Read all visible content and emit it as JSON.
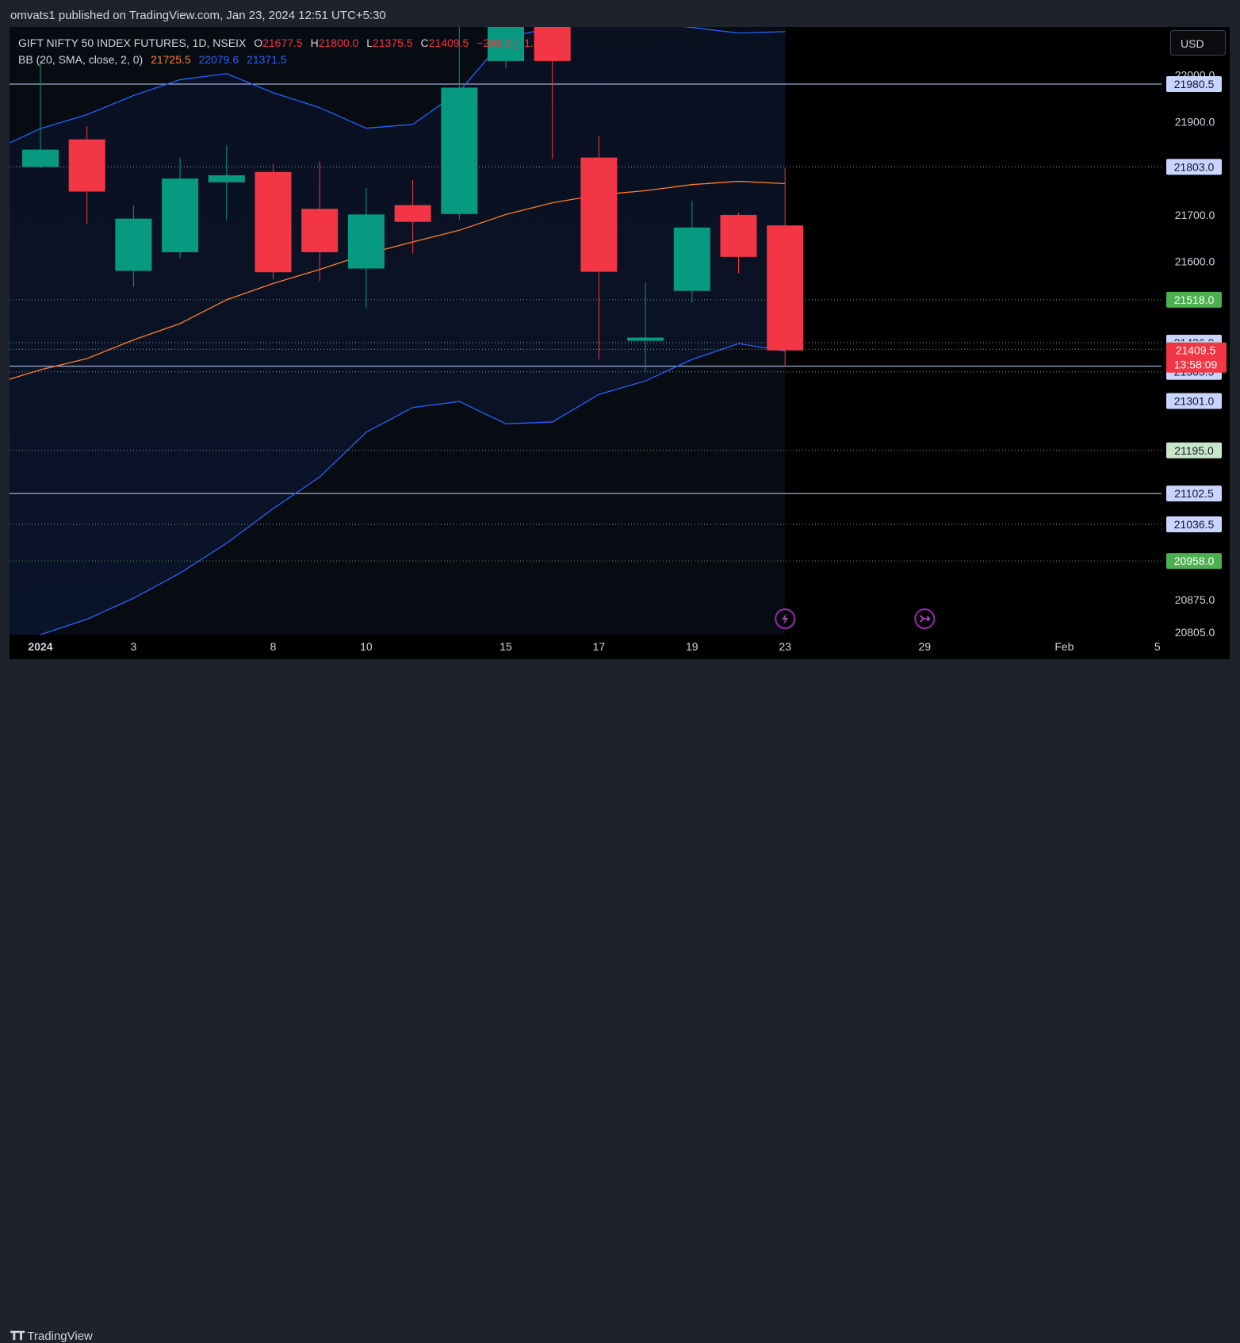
{
  "header": {
    "publish_text": "omvats1 published on TradingView.com, Jan 23, 2024 12:51 UTC+5:30"
  },
  "footer": {
    "logo_text": "TradingView"
  },
  "toolbar": {
    "currency": "USD"
  },
  "legend": {
    "symbol": "GIFT NIFTY 50 INDEX FUTURES, 1D, NSEIX",
    "o_label": "O",
    "o_value": "21677.5",
    "h_label": "H",
    "h_value": "21800.0",
    "l_label": "L",
    "l_value": "21375.5",
    "c_label": "C",
    "c_value": "21409.5",
    "change": "−268.0 (−1.24%)",
    "bb_label": "BB (20, SMA, close, 2, 0)",
    "bb_basis": "21725.5",
    "bb_upper": "22079.6",
    "bb_lower": "21371.5"
  },
  "colors": {
    "up": "#089981",
    "down": "#f23645",
    "basis": "#ff7f27",
    "band": "#2962ff",
    "background": "#000000",
    "frame": "#1e222d"
  },
  "chart_data": {
    "type": "candlestick",
    "ylim": [
      20800,
      22103
    ],
    "x_ticks": [
      {
        "i": 0,
        "label": "2024",
        "bold": true
      },
      {
        "i": 2,
        "label": "3"
      },
      {
        "i": 5,
        "label": "8"
      },
      {
        "i": 7,
        "label": "10"
      },
      {
        "i": 10,
        "label": "15"
      },
      {
        "i": 12,
        "label": "17"
      },
      {
        "i": 14,
        "label": "19"
      },
      {
        "i": 16,
        "label": "23"
      },
      {
        "i": 19,
        "label": "29"
      },
      {
        "i": 22,
        "label": "Feb"
      },
      {
        "i": 24,
        "label": "5"
      }
    ],
    "y_ticks": [
      22000,
      21900,
      21700,
      21600,
      20875,
      20805
    ],
    "candles": [
      {
        "o": 21803,
        "h": 22030,
        "l": 21800,
        "c": 21840
      },
      {
        "o": 21862,
        "h": 21890,
        "l": 21680,
        "c": 21750
      },
      {
        "o": 21580,
        "h": 21720,
        "l": 21545,
        "c": 21692
      },
      {
        "o": 21620,
        "h": 21822,
        "l": 21607,
        "c": 21778
      },
      {
        "o": 21770,
        "h": 21850,
        "l": 21689,
        "c": 21785
      },
      {
        "o": 21792,
        "h": 21810,
        "l": 21562,
        "c": 21577
      },
      {
        "o": 21713,
        "h": 21815,
        "l": 21558,
        "c": 21620
      },
      {
        "o": 21585,
        "h": 21758,
        "l": 21500,
        "c": 21701
      },
      {
        "o": 21721,
        "h": 21775,
        "l": 21617,
        "c": 21685
      },
      {
        "o": 21702,
        "h": 22110,
        "l": 21690,
        "c": 21973
      },
      {
        "o": 22030,
        "h": 22200,
        "l": 22015,
        "c": 22150
      },
      {
        "o": 22120,
        "h": 22150,
        "l": 21820,
        "c": 22030
      },
      {
        "o": 21823,
        "h": 21870,
        "l": 21390,
        "c": 21578
      },
      {
        "o": 21430,
        "h": 21555,
        "l": 21363.5,
        "c": 21437
      },
      {
        "o": 21537,
        "h": 21730,
        "l": 21512,
        "c": 21673
      },
      {
        "o": 21700,
        "h": 21705,
        "l": 21575,
        "c": 21610
      },
      {
        "o": 21677.5,
        "h": 21800,
        "l": 21375.5,
        "c": 21409.5
      }
    ],
    "bb_upper": [
      21885,
      21915,
      21956,
      21990,
      22003,
      21962,
      21930,
      21886,
      21894,
      21965,
      22081,
      22101,
      22117,
      22112,
      22102,
      22090,
      22093
    ],
    "bb_basis": [
      21368,
      21392,
      21432,
      21467,
      21518,
      21553,
      21583,
      21616,
      21642,
      21667,
      21701,
      21726,
      21743,
      21752,
      21765,
      21772,
      21767
    ],
    "bb_lower": [
      20800,
      20833,
      20878,
      20932,
      20996,
      21070,
      21138,
      21234,
      21287,
      21300,
      21252,
      21256,
      21315,
      21344,
      21390,
      21424,
      21408
    ],
    "h_lines": [
      {
        "value": 21980.5,
        "style": "solid",
        "label": "21980.5"
      },
      {
        "value": 21803.0,
        "style": "dotted",
        "label": "21803.0"
      },
      {
        "value": 21518.0,
        "style": "dotted-green",
        "label": "21518.0"
      },
      {
        "value": 21426.0,
        "style": "dotted",
        "label": "21426.0"
      },
      {
        "value": 21412.0,
        "style": "dotted",
        "label": "21412.0"
      },
      {
        "value": 21375.5,
        "style": "solid",
        "label": "21375.5"
      },
      {
        "value": 21363.5,
        "style": "dotted",
        "label": "21363.5"
      },
      {
        "value": 21301.0,
        "style": "none",
        "label": "21301.0"
      },
      {
        "value": 21195.0,
        "style": "dotted",
        "label": "21195.0"
      },
      {
        "value": 21102.5,
        "style": "solid",
        "label": "21102.5"
      },
      {
        "value": 21036.5,
        "style": "dotted",
        "label": "21036.5"
      },
      {
        "value": 20958.0,
        "style": "dotted-green",
        "label": "20958.0"
      }
    ],
    "last_price": {
      "label": "21409.5",
      "countdown": "13:58:09"
    },
    "events": [
      {
        "i": 16,
        "type": "lightning"
      },
      {
        "i": 19,
        "type": "split"
      }
    ]
  }
}
